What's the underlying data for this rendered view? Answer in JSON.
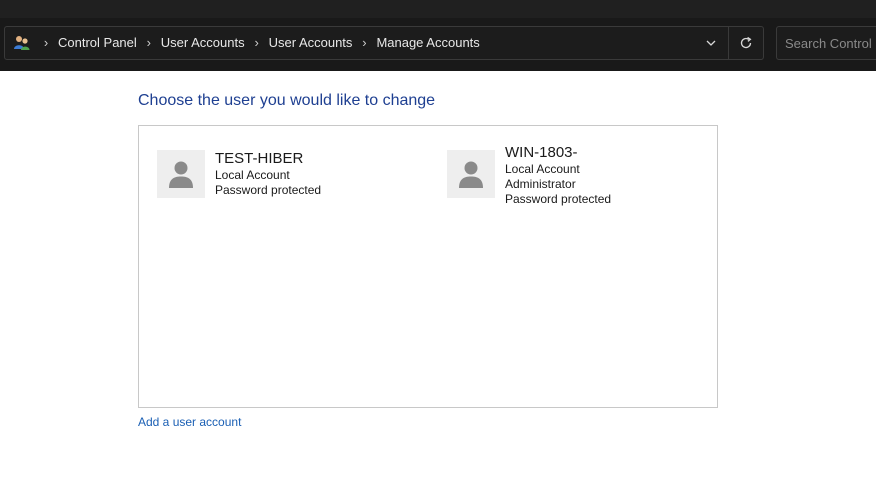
{
  "breadcrumb": {
    "items": [
      "Control Panel",
      "User Accounts",
      "User Accounts",
      "Manage Accounts"
    ]
  },
  "search": {
    "placeholder": "Search Control Panel"
  },
  "heading": "Choose the user you would like to change",
  "accounts": [
    {
      "name": "TEST-HIBER",
      "lines": [
        "Local Account",
        "Password protected"
      ]
    },
    {
      "name": "WIN-1803-",
      "lines": [
        "Local Account",
        "Administrator",
        "Password protected"
      ]
    }
  ],
  "add_account_link": "Add a user account",
  "colors": {
    "titlebar": "#202020",
    "navbar": "#191919",
    "heading": "#1e3f91",
    "link": "#1a5fb4",
    "avatar_bg": "#eeeeee",
    "avatar_glyph": "#8a8a8a"
  },
  "icons": {
    "address": "user-accounts-icon",
    "dropdown": "chevron-down-icon",
    "refresh": "refresh-icon",
    "avatar": "user-avatar-icon"
  }
}
